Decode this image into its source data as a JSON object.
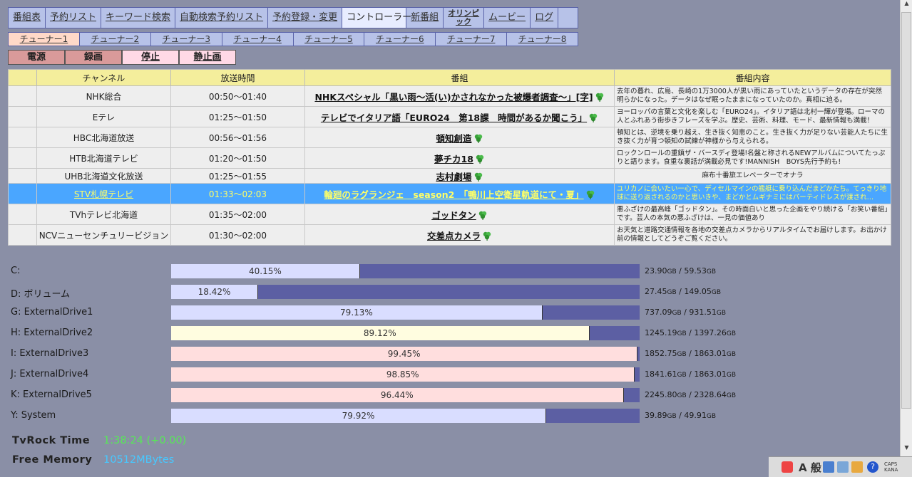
{
  "nav": [
    "番組表",
    "予約リスト",
    "キーワード検索",
    "自動検索予約リスト",
    "予約登録・変更",
    "コントローラー",
    "新番組",
    "オリンピック",
    "ムービー",
    "ログ"
  ],
  "tuners": [
    "チューナー1",
    "チューナー2",
    "チューナー3",
    "チューナー4",
    "チューナー5",
    "チューナー6",
    "チューナー7",
    "チューナー8"
  ],
  "controls": {
    "power": "電源",
    "record": "録画",
    "stop": "停止",
    "still": "静止画"
  },
  "table": {
    "headers": [
      "チャンネル",
      "放送時間",
      "番組",
      "番組内容"
    ],
    "rows": [
      {
        "channel": "NHK総合",
        "time": "00:50〜01:40",
        "title": "NHKスペシャル「黒い雨〜活(い)かされなかった被爆者調査〜」[字]",
        "desc": "去年の暮れ、広島、長崎の1万3000人が黒い雨にあっていたというデータの存在が突然明らかになった。データはなぜ眠ったままになっていたのか。真相に迫る。"
      },
      {
        "channel": "Eテレ",
        "time": "01:25〜01:50",
        "title": "テレビでイタリア語「EURO24　第18課　時間があるか聞こう」",
        "desc": "ヨーロッパの言葉と文化を楽しむ「EURO24」。イタリア語は北村一輝が登場。ローマの人とふれあう街歩きフレーズを学ぶ。歴史、芸術、料理、モード、最新情報も満載！"
      },
      {
        "channel": "HBC北海道放送",
        "time": "00:56〜01:56",
        "title": "頓知創造",
        "desc": "頓知とは、逆境を乗り越え、生き抜く知恵のこと。生き抜く力が足りない芸能人たちに生き抜く力が育つ頓知の試練が神様から与えられる。"
      },
      {
        "channel": "HTB北海道テレビ",
        "time": "01:20〜01:50",
        "title": "夢チカ18",
        "desc": "ロックンロールの重鎮ザ・バースディ登場!名盤と称されるNEWアルバムについてたっぷりと語ります。食重な裏話が満載必見です!MANNISH　BOYS先行予約も!"
      },
      {
        "channel": "UHB北海道文化放送",
        "time": "01:25〜01:55",
        "title": "志村劇場",
        "desc": "麻布十番旅エレベーターでオナラ"
      },
      {
        "channel": "STV札幌テレビ",
        "time": "01:33〜02:03",
        "title": "輪廻のラグランジェ　season2　「鴨川上空衛星軌道にて・夏」",
        "desc": "ユリカノに会いたい一心で、ディセルマインの艦艇に乗り込んだまどかたち。てっきり地球に送り返されるのかと思いきや、まどかとムギナミにはパーティドレスが渡され…"
      },
      {
        "channel": "TVhテレビ北海道",
        "time": "01:35〜02:00",
        "title": "ゴッドタン",
        "desc": "悪ふざけの最高峰「ゴッドタン」。その時面白いと思った企画をやり続ける「お笑い番組」です。芸人の本気の悪ふざけは、一見の価値あり"
      },
      {
        "channel": "NCVニューセンチュリービジョン",
        "time": "01:30〜02:00",
        "title": "交差点カメラ",
        "desc": "お天気と道路交通情報を各地の交差点カメラからリアルタイムでお届けします。お出かけ前の情報としてどうぞご覧ください。"
      }
    ]
  },
  "drives": [
    {
      "label": "C:",
      "percent": 40.15,
      "pct_text": "40.15%",
      "used": "23.90",
      "total": "59.53",
      "color": "#d9ddff"
    },
    {
      "label": "D: ボリューム",
      "percent": 18.42,
      "pct_text": "18.42%",
      "used": "27.45",
      "total": "149.05",
      "color": "#d9ddff"
    },
    {
      "label": "G: ExternalDrive1",
      "percent": 79.13,
      "pct_text": "79.13%",
      "used": "737.09",
      "total": "931.51",
      "color": "#d9ddff"
    },
    {
      "label": "H: ExternalDrive2",
      "percent": 89.12,
      "pct_text": "89.12%",
      "used": "1245.19",
      "total": "1397.26",
      "color": "#fffde0"
    },
    {
      "label": "I: ExternalDrive3",
      "percent": 99.45,
      "pct_text": "99.45%",
      "used": "1852.75",
      "total": "1863.01",
      "color": "#ffdede"
    },
    {
      "label": "J: ExternalDrive4",
      "percent": 98.85,
      "pct_text": "98.85%",
      "used": "1841.61",
      "total": "1863.01",
      "color": "#ffdede"
    },
    {
      "label": "K: ExternalDrive5",
      "percent": 96.44,
      "pct_text": "96.44%",
      "used": "2245.80",
      "total": "2328.64",
      "color": "#ffdede"
    },
    {
      "label": "Y: System",
      "percent": 79.92,
      "pct_text": "79.92%",
      "used": "39.89",
      "total": "49.91",
      "color": "#d9ddff"
    }
  ],
  "unit": "GB",
  "stats": {
    "time_label": "TvRock Time",
    "time_value": "1:38:24 (+0.00)",
    "mem_label": "Free Memory",
    "mem_value": "10512MBytes"
  },
  "tray": {
    "ime_label": "A 般",
    "caps": "CAPS",
    "kana": "KANA"
  }
}
